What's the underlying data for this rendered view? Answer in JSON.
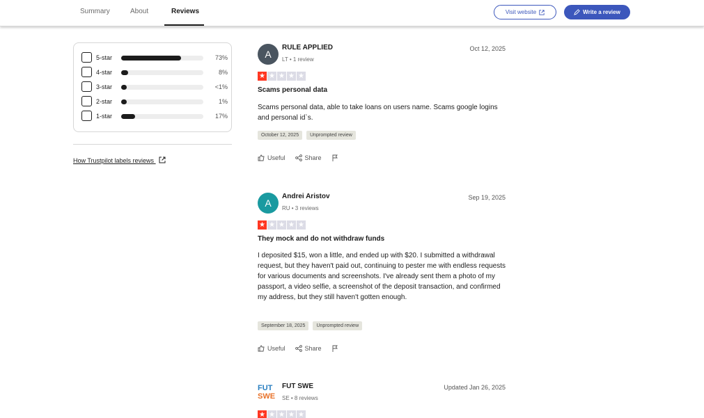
{
  "nav": {
    "tabs": [
      {
        "label": "Summary"
      },
      {
        "label": "About"
      },
      {
        "label": "Reviews"
      }
    ],
    "visit_website": "Visit website",
    "write_review": "Write a review"
  },
  "filters": {
    "rows": [
      {
        "label": "5-star",
        "percent": "73%",
        "value": 0.73
      },
      {
        "label": "4-star",
        "percent": "8%",
        "value": 0.08
      },
      {
        "label": "3-star",
        "percent": "<1%",
        "value": 0.005
      },
      {
        "label": "2-star",
        "percent": "1%",
        "value": 0.01
      },
      {
        "label": "1-star",
        "percent": "17%",
        "value": 0.17
      }
    ],
    "labels_link": "How Trustpilot labels reviews"
  },
  "reviews": [
    {
      "initial": "A",
      "avatar_color": "#4a5560",
      "name": "RULE APPLIED",
      "meta": "LT • 1 review",
      "date": "Oct 12, 2025",
      "rating": 1,
      "title": "Scams personal data",
      "body": "Scams personal data, able to take loans on users name. Scams google logins and personal id`s.",
      "experience_date": "October 12, 2025",
      "tag": "Unprompted review",
      "useful": "Useful",
      "share": "Share"
    },
    {
      "initial": "A",
      "avatar_color": "#1a9aa0",
      "name": "Andrei Aristov",
      "meta": "RU • 3 reviews",
      "date": "Sep 19, 2025",
      "rating": 1,
      "title": "They mock and do not withdraw funds",
      "body": "I deposited $15, won a little, and ended up with $20. I submitted a withdrawal request, but they haven't paid out, continuing to pester me with endless requests for various documents and screenshots. I've already sent them a photo of my passport, a video selfie, a screenshot of the deposit transaction, and confirmed my address, but they still haven't gotten enough.",
      "experience_date": "September 18, 2025",
      "tag": "Unprompted review",
      "useful": "Useful",
      "share": "Share"
    },
    {
      "logo_text_top": "FUT",
      "logo_text_bottom": "SWE",
      "name": "FUT SWE",
      "meta": "SE • 8 reviews",
      "date": "Updated Jan 26, 2025",
      "rating": 1
    }
  ],
  "colors": {
    "accent": "#3c57bc",
    "star_on": "#ff3722",
    "star_off": "#dcdce6"
  }
}
